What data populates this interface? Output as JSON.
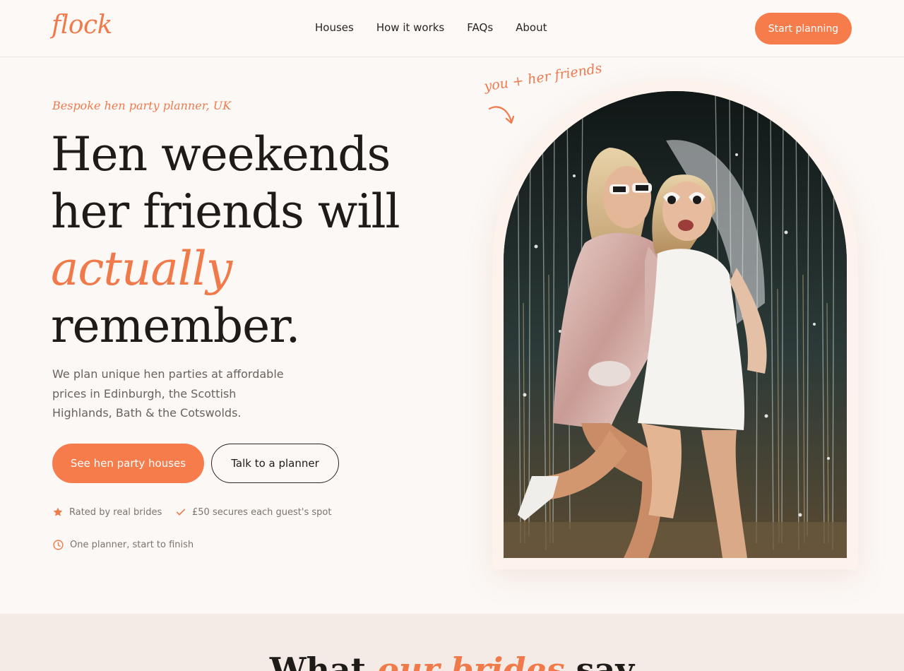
{
  "header": {
    "logo": "flock",
    "nav": [
      "Houses",
      "How it works",
      "FAQs",
      "About"
    ],
    "cta": "Start planning"
  },
  "hero": {
    "eyebrow": "Bespoke hen party planner, UK",
    "headline": {
      "line1": "Hen weekends",
      "line2": "her friends will",
      "accent": "actually",
      "line4": "remember."
    },
    "lede": "We plan unique hen parties at affordable prices in Edinburgh, the Scottish Highlands, Bath & the Cotswolds.",
    "primary_cta": "See hen party houses",
    "secondary_cta": "Talk to a planner",
    "badges": [
      {
        "icon": "star-icon",
        "text": "Rated by real brides"
      },
      {
        "icon": "check-icon",
        "text": "£50 secures each guest's spot"
      },
      {
        "icon": "clock-icon",
        "text": "One planner, start to finish"
      }
    ],
    "photo_note": "you + her friends"
  },
  "testimonials": {
    "title_before": "What ",
    "title_accent": "our brides",
    "title_after": " say"
  },
  "colors": {
    "accent": "#f67c4c",
    "background": "#fcf8f5",
    "band": "#f4ebe6"
  }
}
